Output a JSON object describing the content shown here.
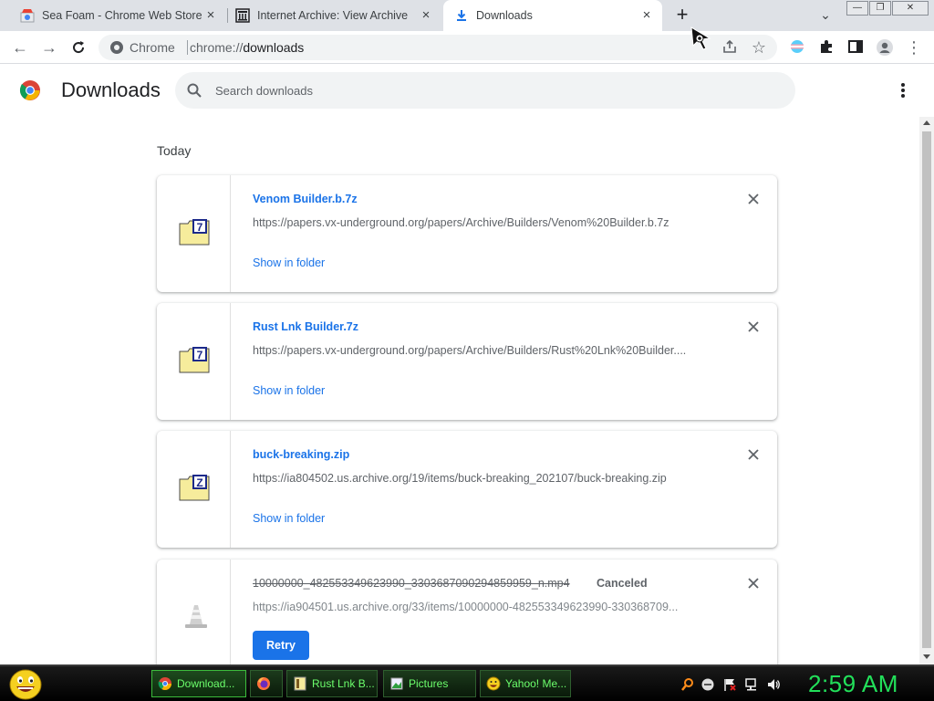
{
  "tabs": [
    {
      "title": "Sea Foam - Chrome Web Store",
      "active": false
    },
    {
      "title": "Internet Archive: View Archive",
      "active": false
    },
    {
      "title": "Downloads",
      "active": true
    }
  ],
  "omnibox": {
    "chip_label": "Chrome",
    "url_scheme": "chrome://",
    "url_path": "downloads"
  },
  "header": {
    "title": "Downloads",
    "search_placeholder": "Search downloads"
  },
  "section_label": "Today",
  "downloads": [
    {
      "file_name": "Venom Builder.b.7z",
      "url": "https://papers.vx-underground.org/papers/Archive/Builders/Venom%20Builder.b.7z",
      "action": "Show in folder",
      "icon": "7z-archive-icon"
    },
    {
      "file_name": "Rust Lnk Builder.7z",
      "url": "https://papers.vx-underground.org/papers/Archive/Builders/Rust%20Lnk%20Builder....",
      "action": "Show in folder",
      "icon": "7z-archive-icon"
    },
    {
      "file_name": "buck-breaking.zip",
      "url": "https://ia804502.us.archive.org/19/items/buck-breaking_202107/buck-breaking.zip",
      "action": "Show in folder",
      "icon": "zip-archive-icon"
    },
    {
      "file_name": "10000000_482553349623990_3303687090294859959_n.mp4",
      "status": "Canceled",
      "url": "https://ia904501.us.archive.org/33/items/10000000-482553349623990-330368709...",
      "action": "Retry",
      "icon": "vlc-cone-icon"
    }
  ],
  "taskbar": {
    "items": [
      {
        "label": "Download..."
      },
      {
        "label": ""
      },
      {
        "label": "Rust Lnk B..."
      },
      {
        "label": "Pictures"
      },
      {
        "label": "Yahoo! Me..."
      }
    ],
    "clock": "2:59 AM"
  },
  "colors": {
    "accent": "#1a73e8",
    "tabstrip": "#dee1e6",
    "clock": "#22e05a",
    "taskbar_text": "#6cff6c"
  }
}
